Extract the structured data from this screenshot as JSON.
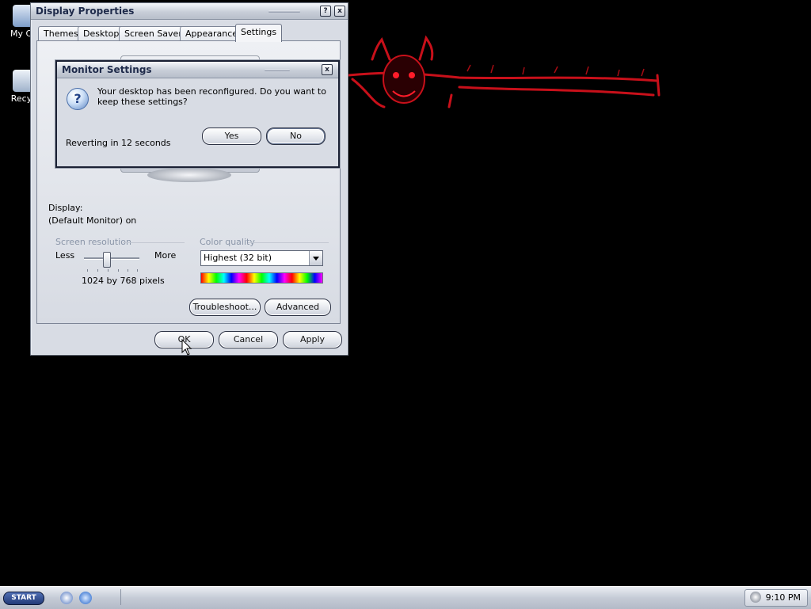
{
  "desktop": {
    "icons": [
      {
        "label": "My Co"
      },
      {
        "label": "Recyc"
      }
    ]
  },
  "display_properties": {
    "title": "Display Properties",
    "tabs": [
      {
        "label": "Themes"
      },
      {
        "label": "Desktop"
      },
      {
        "label": "Screen Saver"
      },
      {
        "label": "Appearance"
      },
      {
        "label": "Settings"
      }
    ],
    "active_tab": "Settings",
    "display_label": "Display:",
    "display_value": "(Default Monitor) on",
    "screen_resolution": {
      "label": "Screen resolution",
      "less_label": "Less",
      "more_label": "More",
      "value_text": "1024 by 768 pixels"
    },
    "color_quality": {
      "label": "Color quality",
      "selected": "Highest (32 bit)"
    },
    "buttons": {
      "troubleshoot": "Troubleshoot...",
      "advanced": "Advanced",
      "ok": "OK",
      "cancel": "Cancel",
      "apply": "Apply"
    },
    "title_buttons": {
      "help": "?",
      "close": "x"
    }
  },
  "monitor_settings": {
    "title": "Monitor Settings",
    "message": "Your desktop has been reconfigured.  Do you want to keep these settings?",
    "countdown": "Reverting in 12 seconds",
    "buttons": {
      "yes": "Yes",
      "no": "No"
    },
    "close": "x",
    "icon": "question-icon"
  },
  "taskbar": {
    "start_label": "START",
    "clock": "9:10 PM"
  },
  "colors": {
    "desktop": "#000000",
    "wallpaper_accent": "#d0121a",
    "window_face": "#d8dce4"
  }
}
